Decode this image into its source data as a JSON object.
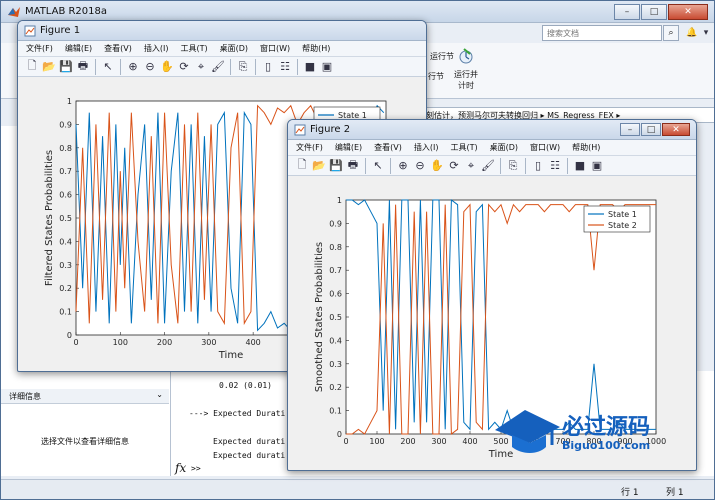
{
  "main": {
    "title": "MATLAB R2018a",
    "search_placeholder": "搜索文档",
    "ribbon_labels": [
      "运行节",
      "运行并\n计时",
      "行节"
    ],
    "path_text": "刻估计，预测马尔可夫转换回归 ▸ MS_Regress_FEX ▸",
    "detail_header": "详细信息",
    "detail_text": "选择文件以查看详细信息",
    "cmd_lines": [
      "0.02 (0.01)",
      "---> Expected Durati",
      "Expected durati",
      "Expected durati"
    ],
    "prompt": ">>",
    "status_row": "行 1",
    "status_col": "列 1"
  },
  "figures": [
    {
      "title": "Figure 1",
      "menus": [
        "文件(F)",
        "编辑(E)",
        "查看(V)",
        "插入(I)",
        "工具(T)",
        "桌面(D)",
        "窗口(W)",
        "帮助(H)"
      ]
    },
    {
      "title": "Figure 2",
      "menus": [
        "文件(F)",
        "编辑(E)",
        "查看(V)",
        "插入(I)",
        "工具(T)",
        "桌面(D)",
        "窗口(W)",
        "帮助(H)"
      ]
    }
  ],
  "chart_data": [
    {
      "type": "line",
      "ylabel": "Filtered States Probabilities",
      "xlabel": "Time",
      "xlim": [
        0,
        700
      ],
      "ylim": [
        0,
        1
      ],
      "xticks": [
        0,
        100,
        200,
        300,
        400,
        500,
        600,
        700
      ],
      "yticks": [
        0,
        0.1,
        0.2,
        0.3,
        0.4,
        0.5,
        0.6,
        0.7,
        0.8,
        0.9,
        1
      ],
      "series": [
        {
          "name": "State 1",
          "color": "#0072BD"
        },
        {
          "name": "State 2",
          "color": "#D95319"
        }
      ],
      "x": [
        0,
        15,
        30,
        45,
        60,
        75,
        90,
        100,
        110,
        125,
        140,
        155,
        170,
        185,
        200,
        215,
        230,
        245,
        260,
        275,
        290,
        305,
        320,
        335,
        350,
        365,
        380,
        395,
        410,
        425,
        440,
        455,
        470,
        485,
        500,
        515,
        530,
        545,
        560,
        575,
        590,
        605,
        620,
        635,
        650,
        665,
        680,
        695
      ],
      "state1": [
        0.9,
        0.2,
        0.95,
        0.1,
        0.85,
        0.05,
        0.9,
        0.3,
        0.8,
        0.05,
        0.6,
        0.9,
        0.15,
        0.95,
        0.05,
        0.7,
        0.95,
        0.1,
        0.9,
        0.05,
        0.85,
        0.1,
        0.9,
        0.95,
        0.2,
        0.05,
        0.95,
        0.9,
        0.02,
        0.05,
        0.1,
        0.03,
        0.05,
        0.02,
        0.1,
        0.05,
        0.02,
        0.08,
        0.03,
        0.05,
        0.9,
        0.95,
        0.05,
        0.9,
        0.95,
        0.9,
        0.98,
        0.95
      ],
      "state2": [
        0.1,
        0.8,
        0.05,
        0.9,
        0.15,
        0.95,
        0.1,
        0.7,
        0.2,
        0.95,
        0.4,
        0.1,
        0.85,
        0.05,
        0.95,
        0.3,
        0.05,
        0.9,
        0.1,
        0.95,
        0.15,
        0.9,
        0.1,
        0.05,
        0.8,
        0.95,
        0.05,
        0.1,
        0.98,
        0.95,
        0.9,
        0.97,
        0.95,
        0.98,
        0.9,
        0.95,
        0.98,
        0.92,
        0.97,
        0.95,
        0.1,
        0.05,
        0.95,
        0.1,
        0.05,
        0.1,
        0.02,
        0.05
      ],
      "legend": "top-right"
    },
    {
      "type": "line",
      "ylabel": "Smoothed States Probabilities",
      "xlabel": "Time",
      "xlim": [
        0,
        1000
      ],
      "ylim": [
        0,
        1
      ],
      "xticks": [
        0,
        100,
        200,
        300,
        400,
        500,
        600,
        700,
        800,
        900,
        1000
      ],
      "yticks": [
        0,
        0.1,
        0.2,
        0.3,
        0.4,
        0.5,
        0.6,
        0.7,
        0.8,
        0.9,
        1
      ],
      "series": [
        {
          "name": "State 1",
          "color": "#0072BD"
        },
        {
          "name": "State 2",
          "color": "#D95319"
        }
      ],
      "x": [
        0,
        20,
        40,
        60,
        80,
        100,
        120,
        140,
        160,
        180,
        200,
        220,
        240,
        260,
        280,
        300,
        320,
        340,
        360,
        380,
        400,
        420,
        440,
        460,
        480,
        500,
        520,
        540,
        560,
        580,
        600,
        620,
        640,
        660,
        680,
        700,
        720,
        740,
        760,
        780,
        800,
        820,
        840,
        860,
        880,
        900,
        920,
        940,
        960,
        980,
        1000
      ],
      "state1": [
        1,
        1,
        0.98,
        1,
        0.95,
        0.9,
        0.1,
        1,
        0.02,
        1,
        1,
        0.05,
        1,
        0.05,
        1,
        1,
        0.02,
        1,
        0.98,
        0.05,
        0.02,
        0.95,
        0.98,
        0.02,
        0.05,
        0.02,
        0.1,
        0.02,
        0.05,
        0.02,
        0.02,
        0.02,
        0.05,
        0.02,
        0.02,
        0.02,
        0.05,
        0.02,
        0.02,
        0.02,
        0.3,
        0.02,
        0.02,
        0.02,
        0.05,
        0.02,
        0.02,
        0.02,
        0.02,
        0.02,
        0.02
      ],
      "state2": [
        0,
        0,
        0.02,
        0,
        0.05,
        0.1,
        0.9,
        0,
        0.98,
        0,
        0,
        0.95,
        0,
        0.95,
        0,
        0,
        0.98,
        0,
        0.02,
        0.95,
        0.98,
        0.05,
        0.02,
        0.98,
        0.95,
        0.98,
        0.9,
        0.98,
        0.95,
        0.98,
        0.98,
        0.98,
        0.95,
        0.98,
        0.98,
        0.98,
        0.95,
        0.98,
        0.98,
        0.98,
        0.7,
        0.98,
        0.98,
        0.98,
        0.95,
        0.98,
        0.98,
        0.98,
        0.98,
        0.98,
        0.98
      ],
      "legend": "top-right"
    }
  ],
  "watermark": {
    "brand": "必过源码",
    "url": "Biguo100.com"
  }
}
